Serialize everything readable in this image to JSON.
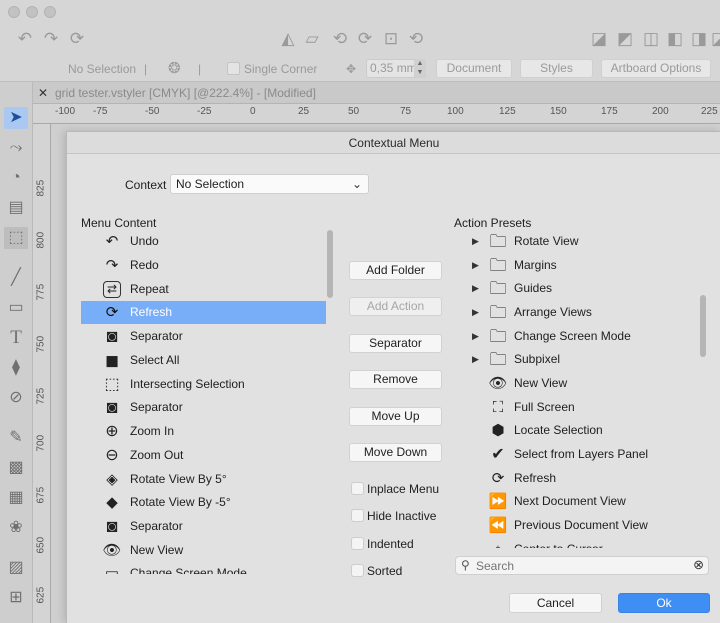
{
  "app": {
    "toolbar_icons": [
      "undo-icon",
      "redo-icon",
      "refresh-icon",
      "view-icons"
    ],
    "propbar": {
      "selection": "No Selection",
      "single_corner": "Single Corner",
      "size_value": "0,35 mm",
      "document_btn": "Document",
      "styles_btn": "Styles",
      "artboard_btn": "Artboard Options"
    },
    "tab_title": "grid tester.vstyler [CMYK] [@222.4%] - [Modified]",
    "hruler": [
      "-100",
      "-75",
      "-50",
      "-25",
      "0",
      "25",
      "50",
      "75",
      "100",
      "125",
      "150",
      "175",
      "200",
      "225"
    ],
    "vruler": [
      "825",
      "800",
      "775",
      "750",
      "725",
      "700",
      "675",
      "650",
      "625"
    ]
  },
  "dialog": {
    "title": "Contextual Menu",
    "context_label": "Context",
    "context_value": "No Selection",
    "menu_content_label": "Menu Content",
    "menu_items": [
      {
        "label": "Undo",
        "icon": "undo-icon"
      },
      {
        "label": "Redo",
        "icon": "redo-icon"
      },
      {
        "label": "Repeat",
        "icon": "repeat-icon"
      },
      {
        "label": "Refresh",
        "icon": "refresh-icon",
        "selected": true
      },
      {
        "label": "Separator",
        "icon": "separator-icon"
      },
      {
        "label": "Select All",
        "icon": "select-all-icon"
      },
      {
        "label": "Intersecting Selection",
        "icon": "intersecting-selection-icon"
      },
      {
        "label": "Separator",
        "icon": "separator-icon"
      },
      {
        "label": "Zoom In",
        "icon": "zoom-in-icon"
      },
      {
        "label": "Zoom Out",
        "icon": "zoom-out-icon"
      },
      {
        "label": "Rotate View By 5°",
        "icon": "rotate-cw-icon"
      },
      {
        "label": "Rotate View By -5°",
        "icon": "rotate-ccw-icon"
      },
      {
        "label": "Separator",
        "icon": "separator-icon"
      },
      {
        "label": "New View",
        "icon": "eye-plus-icon"
      },
      {
        "label": "Change Screen Mode",
        "icon": "screen-mode-icon"
      }
    ],
    "buttons": {
      "add_folder": "Add Folder",
      "add_action": "Add Action",
      "separator": "Separator",
      "remove": "Remove",
      "move_up": "Move Up",
      "move_down": "Move Down"
    },
    "checkboxes": {
      "inplace_menu": "Inplace Menu",
      "hide_inactive": "Hide Inactive",
      "indented": "Indented",
      "sorted": "Sorted"
    },
    "action_presets_label": "Action Presets",
    "presets": [
      {
        "label": "Rotate View",
        "folder": true
      },
      {
        "label": "Margins",
        "folder": true
      },
      {
        "label": "Guides",
        "folder": true
      },
      {
        "label": "Arrange Views",
        "folder": true
      },
      {
        "label": "Change Screen Mode",
        "folder": true
      },
      {
        "label": "Subpixel",
        "folder": true
      },
      {
        "label": "New View",
        "icon": "eye-plus-icon"
      },
      {
        "label": "Full Screen",
        "icon": "full-screen-icon"
      },
      {
        "label": "Locate Selection",
        "icon": "locate-icon"
      },
      {
        "label": "Select from Layers Panel",
        "icon": "select-layers-icon"
      },
      {
        "label": "Refresh",
        "icon": "refresh-icon"
      },
      {
        "label": "Next Document View",
        "icon": "next-doc-icon"
      },
      {
        "label": "Previous Document View",
        "icon": "prev-doc-icon"
      },
      {
        "label": "Center to Cursor",
        "icon": "center-cursor-icon"
      }
    ],
    "search_placeholder": "Search",
    "cancel": "Cancel",
    "ok": "Ok"
  }
}
